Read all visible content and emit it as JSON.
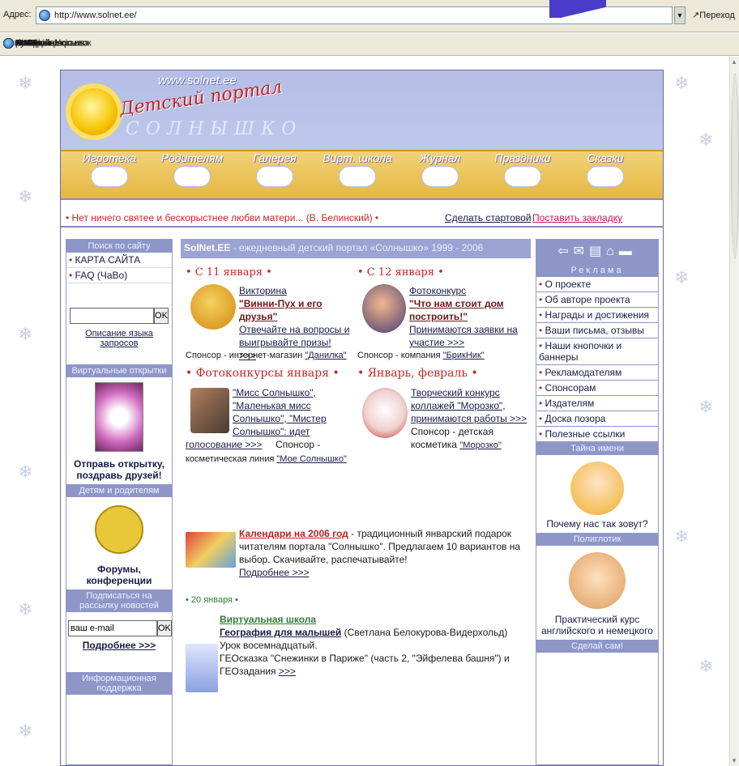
{
  "browser": {
    "address_label": "Адрес:",
    "url": "http://www.solnet.ee/",
    "go_label": "Переход",
    "links_label": "Ссылки",
    "links": [
      "Пікардійці",
      "Контекст-Украина",
      "AV Threader",
      "Furl It",
      "IfyrWiki",
      "post to del.icio.us",
      "ЖЖ",
      "Настройка ссылок",
      "AIN"
    ]
  },
  "banner": {
    "url": "www.solnet.ee",
    "title": "Детский портал",
    "subtitle": "СОЛНЫШКО",
    "tabs": [
      "Игротека",
      "Родителям",
      "Галерея",
      "Вирт. школа",
      "Журнал",
      "Праздники",
      "Сказки"
    ]
  },
  "quote_bar": {
    "quote": "• Нет ничего святее и бескорыстнее любви матери... (В. Белинский) •",
    "make_start": "Сделать стартовой",
    "bookmark": "Поставить закладку"
  },
  "left": {
    "search_header": "Поиск по сайту",
    "links": [
      "КАРТА САЙТА",
      "FAQ (ЧаВо)"
    ],
    "ok": "OK",
    "query_desc": "Описание языка запросов",
    "cards_header": "Виртуальные открытки",
    "cards_caption": "Отправь открытку, поздравь друзей!",
    "kids_header": "Детям и родителям",
    "forums_caption": "Форумы, конференции",
    "subscribe_header": "Подписаться на рассылку новостей",
    "email_value": "ваш e-mail",
    "more": "Подробнее >>>",
    "info_header": "Информационная поддержка"
  },
  "center": {
    "header_site": "SolNet.EE",
    "header_text": " - ежедневный детский портал «Солнышко» 1999 - 2006",
    "s1_title": "• С 11 января •",
    "s1_l1": "Викторина",
    "s1_l2": "\"Винни-Пух и его друзья\"",
    "s1_l3": "Отвечайте на вопросы и",
    "s1_l4": "выигрывайте призы!",
    "s1_more": ">>>",
    "s1_sponsor_pre": "Спонсор - интернет-магазин ",
    "s1_sponsor": "\"Данилка\"",
    "s2_title": "• С 12 января •",
    "s2_l1": "Фотоконкурс",
    "s2_l2": "\"Что нам стоит дом",
    "s2_l3": "построить!\"",
    "s2_l4": "Принимаются заявки на",
    "s2_l5": "участие >>>",
    "s2_sponsor_pre": "Спонсор - компания ",
    "s2_sponsor": "\"БрикНик\"",
    "s3_title": "• Фотоконкурсы января •",
    "s3_l1": "\"Мисс Солнышко\",",
    "s3_l2": "\"Маленькая мисс",
    "s3_l3": "Солнышко\", \"Мистер",
    "s3_l4": "Солнышко\": идет",
    "s3_l5": "голосование >>>",
    "s3_sponsor_pre": "Спонсор -",
    "s3_sponsor_line": "косметическая линия ",
    "s3_sponsor": "\"Мое Солнышко\"",
    "s4_title": "• Январь, февраль •",
    "s4_l1": "Творческий конкурс",
    "s4_l2": "коллажей \"Морозко\",",
    "s4_l3": "принимаются работы >>>",
    "s4_l4": "Спонсор - детская",
    "s4_l5_pre": "косметика ",
    "s4_l5": "\"Морозко\"",
    "cal_title": "Календари на 2006 год",
    "cal_text1": " - традиционный январский подарок",
    "cal_text2": "читателям портала \"Солнышко\". Предлагаем 10 вариантов на",
    "cal_text3": "выбор. Скачивайте, распечатывайте!",
    "cal_more": "Подробнее >>>",
    "date2": "• 20 января •",
    "vs_title": "Виртуальная школа",
    "geo_title": "География для малышей",
    "geo_author": " (Светлана Белокурова-Видерхольд)",
    "geo_l2": "Урок восемнадцатый.",
    "geo_l3": "ГЕОсказка \"Снежинки в Париже\" (часть 2, \"Эйфелева башня\") и",
    "geo_l4": "ГЕОзадания ",
    "geo_more": ">>>"
  },
  "right": {
    "ad_header": "Реклама",
    "links": [
      "О проекте",
      "Об авторе проекта",
      "Награды и достижения",
      "Ваши письма, отзывы",
      "Наши кнопочки и баннеры",
      "Рекламодателям",
      "Спонсорам",
      "Издателям",
      "Доска позора",
      "Полезные ссылки"
    ],
    "name_header": "Тайна имени",
    "name_caption": "Почему нас так зовут?",
    "poly_header": "Полиглотик",
    "poly_caption": "Практический курс английского и немецкого",
    "diy_header": "Сделай сам!"
  }
}
